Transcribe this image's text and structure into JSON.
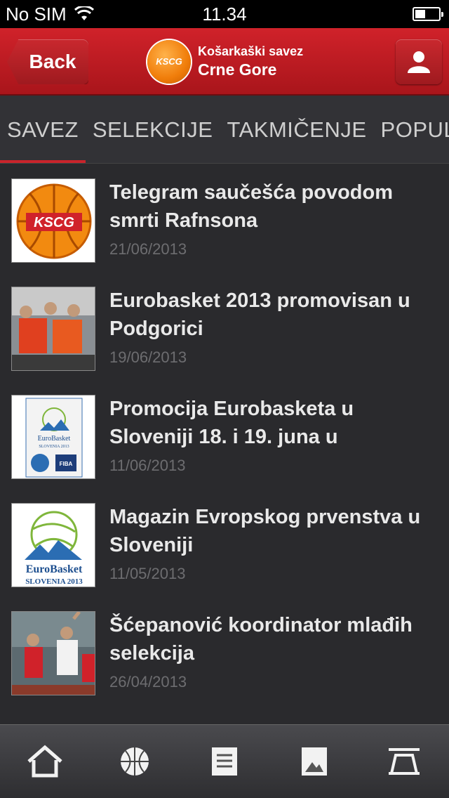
{
  "status": {
    "carrier": "No SIM",
    "time": "11.34"
  },
  "header": {
    "back_label": "Back",
    "logo_text": "KSCG",
    "brand_line1": "Košarkaški savez",
    "brand_line2": "Crne Gore"
  },
  "tabs": [
    {
      "label": "SAVEZ"
    },
    {
      "label": "SELEKCIJE"
    },
    {
      "label": "TAKMIČENJE"
    },
    {
      "label": "POPULARNO"
    }
  ],
  "news": [
    {
      "title": "Telegram saučešća povodom smrti Rafnsona",
      "date": "21/06/2013"
    },
    {
      "title": "Eurobasket 2013 promovisan u Podgorici",
      "date": "19/06/2013"
    },
    {
      "title": "Promocija Eurobasketa u Sloveniji 18. i 19. juna u",
      "date": "11/06/2013"
    },
    {
      "title": "Magazin Evropskog prvenstva u Sloveniji",
      "date": "11/05/2013"
    },
    {
      "title": "Šćepanović koordinator mlađih selekcija",
      "date": "26/04/2013"
    }
  ],
  "thumb_texts": {
    "kscg": "KSCG",
    "eurobasket": "EuroBasket",
    "slovenia": "SLOVENIA 2013",
    "fiba": "FIBA"
  },
  "toolbar": [
    "home-icon",
    "basketball-icon",
    "document-icon",
    "gallery-icon",
    "ticket-icon"
  ],
  "colors": {
    "accent": "#c9242b",
    "background": "#2a2a2d"
  }
}
